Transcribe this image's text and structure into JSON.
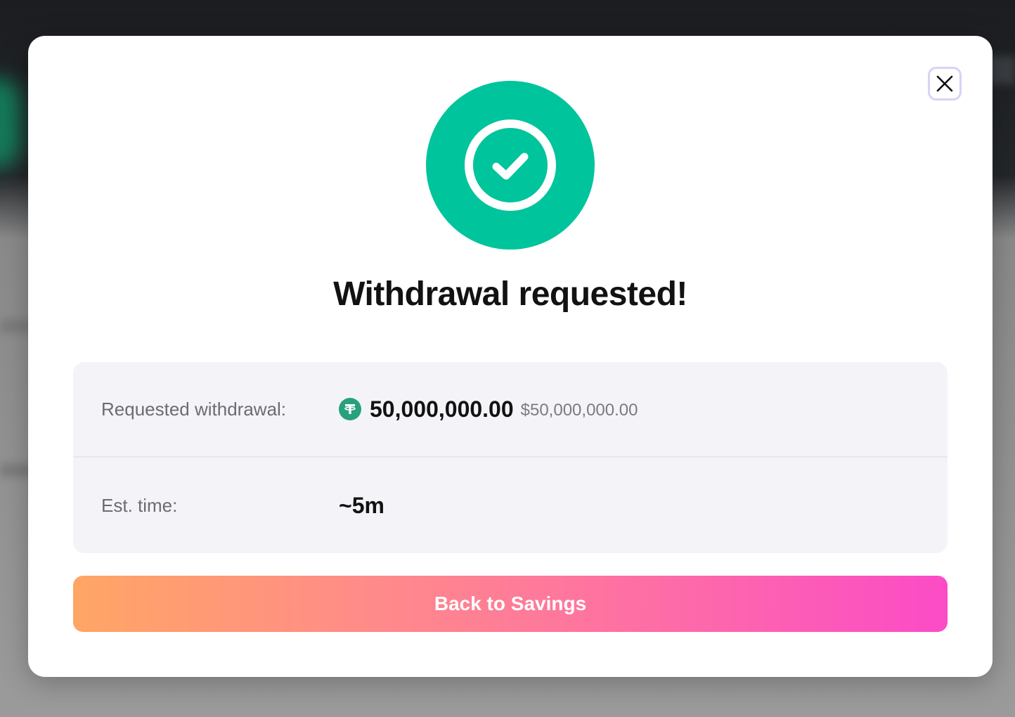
{
  "modal": {
    "title": "Withdrawal requested!",
    "close_icon": "close-icon",
    "success_icon": "check-circle-icon",
    "success_color": "#00c49c"
  },
  "details": {
    "withdrawal": {
      "label": "Requested withdrawal:",
      "token_icon": "tether-usdt-icon",
      "token_color": "#26a17b",
      "amount": "50,000,000.00",
      "fiat_value": "$50,000,000.00"
    },
    "eta": {
      "label": "Est. time:",
      "value": "~5m"
    }
  },
  "cta": {
    "label": "Back to Savings",
    "gradient": [
      "#ffa665",
      "#ff8a8a",
      "#fd6aa9",
      "#fc4bc7"
    ]
  }
}
